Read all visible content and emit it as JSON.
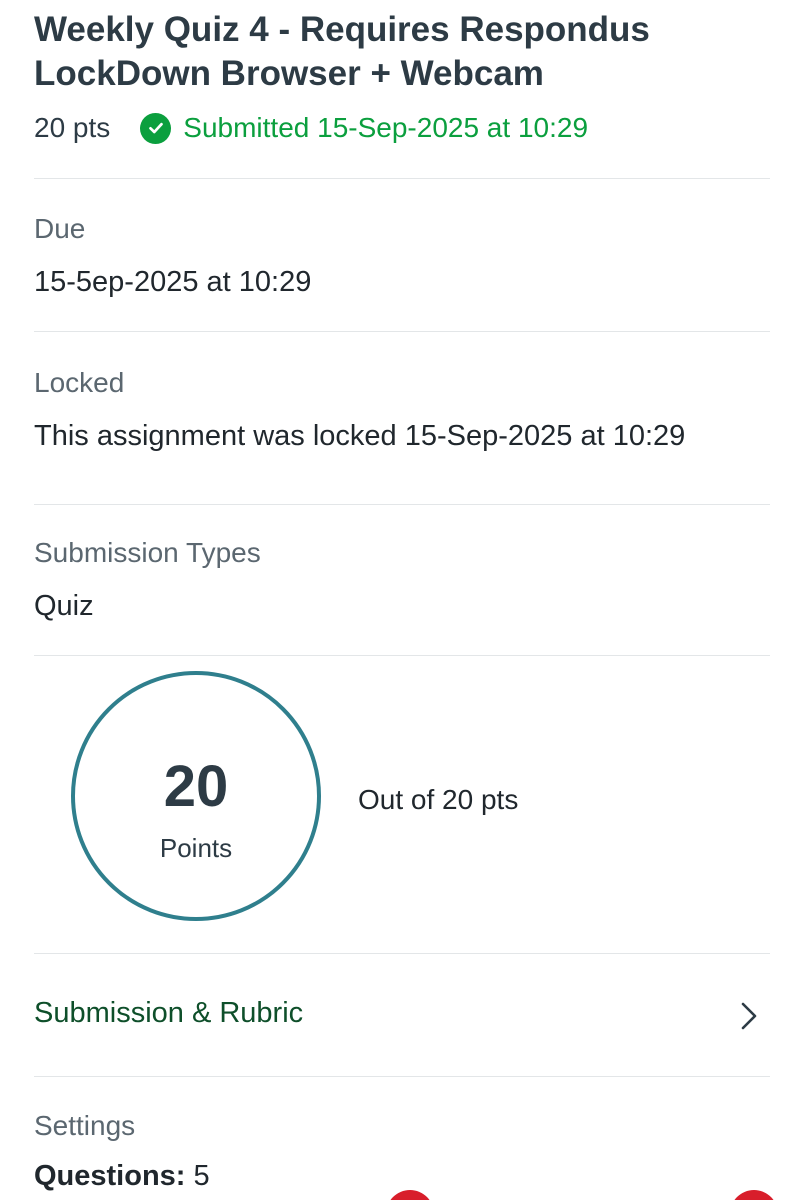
{
  "assignment": {
    "title": "Weekly Quiz 4 - Requires Respondus LockDown Browser + Webcam",
    "points": "20 pts",
    "status": "Submitted 15-Sep-2025 at 10:29"
  },
  "due": {
    "label": "Due",
    "value": "15-5ep-2025 at 10:29"
  },
  "locked": {
    "label": "Locked",
    "value": "This assignment was locked 15-Sep-2025 at 10:29"
  },
  "submission_types": {
    "label": "Submission Types",
    "value": "Quiz"
  },
  "grade": {
    "score": "20",
    "unit": "Points",
    "out_of": "Out of 20 pts"
  },
  "submission_rubric": {
    "label": "Submission & Rubric",
    "icon": "chevron-right-icon"
  },
  "settings": {
    "label": "Settings",
    "questions_label": "Questions:",
    "questions_value": "5"
  },
  "colors": {
    "submitted": "#0b9f3e",
    "grade_ring": "#2f7f8d",
    "link": "#0e4f2a",
    "badge": "#d81e2b"
  }
}
